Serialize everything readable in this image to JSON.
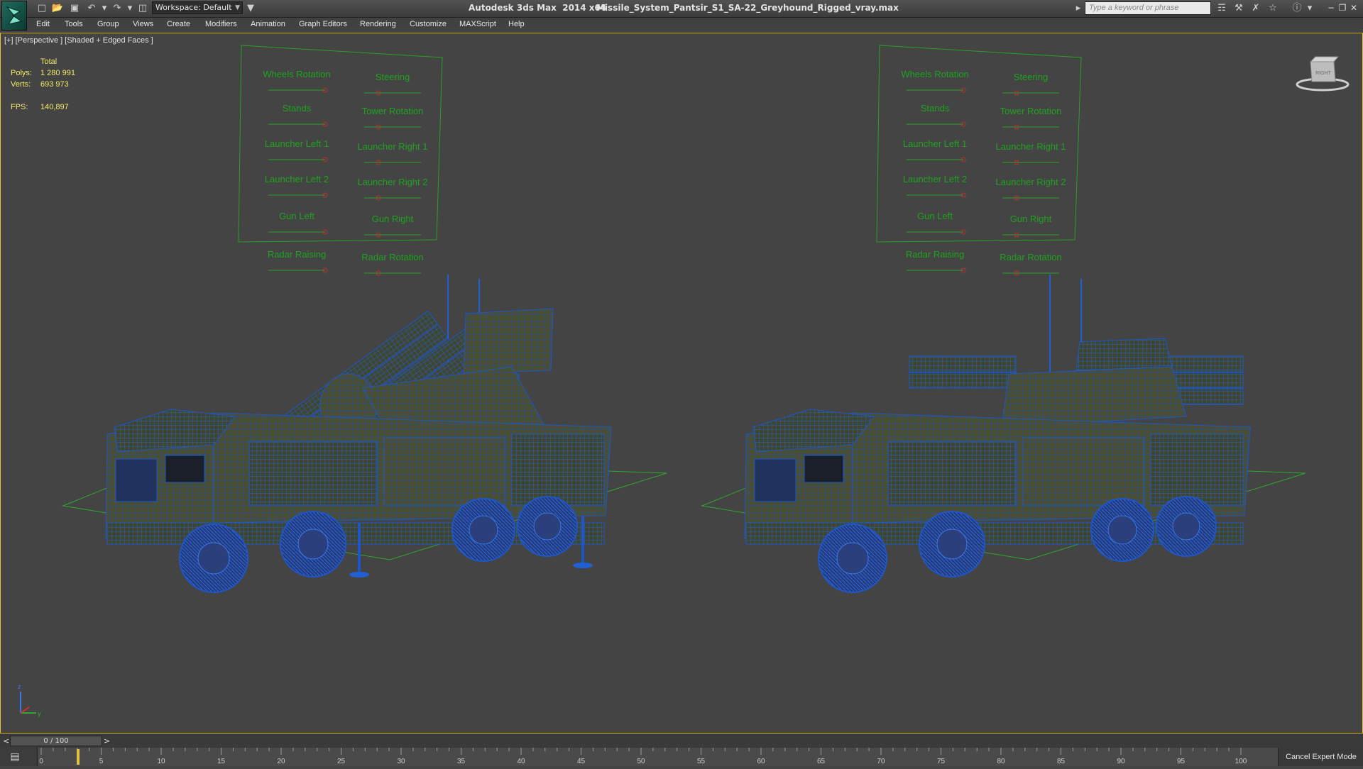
{
  "titlebar": {
    "workspace": "Workspace: Default",
    "app_title": "Autodesk 3ds Max  2014 x64",
    "file_name": "Missile_System_Pantsir_S1_SA-22_Greyhound_Rigged_vray.max",
    "search_placeholder": "Type a keyword or phrase"
  },
  "menu": [
    "Edit",
    "Tools",
    "Group",
    "Views",
    "Create",
    "Modifiers",
    "Animation",
    "Graph Editors",
    "Rendering",
    "Customize",
    "MAXScript",
    "Help"
  ],
  "viewport": {
    "label": "[+] [Perspective ] [Shaded + Edged Faces ]",
    "stats": {
      "header": "Total",
      "polys_label": "Polys:",
      "polys_value": "1 280 991",
      "verts_label": "Verts:",
      "verts_value": "693 973",
      "fps_label": "FPS:",
      "fps_value": "140,897"
    },
    "viewcube_label": "RIGHT",
    "control_labels": [
      "Wheels Rotation",
      "Steering",
      "Stands",
      "Tower Rotation",
      "Launcher Left 1",
      "Launcher Right 1",
      "Launcher Left 2",
      "Launcher Right 2",
      "Gun Left",
      "Gun Right",
      "Radar Raising",
      "Radar Rotation"
    ],
    "axis_labels": [
      "z",
      "y"
    ]
  },
  "timeline": {
    "frame_display": "0 / 100",
    "prev": "<",
    "next": ">",
    "ticks": [
      0,
      5,
      10,
      15,
      20,
      25,
      30,
      35,
      40,
      45,
      50,
      55,
      60,
      65,
      70,
      75,
      80,
      85,
      90,
      95,
      100
    ],
    "expert_mode": "Cancel Expert Mode"
  },
  "colors": {
    "accent": "#e2c23c",
    "wire": "#1e56c8",
    "panel_text": "#1fa21f",
    "stats_text": "#f1e96a"
  }
}
